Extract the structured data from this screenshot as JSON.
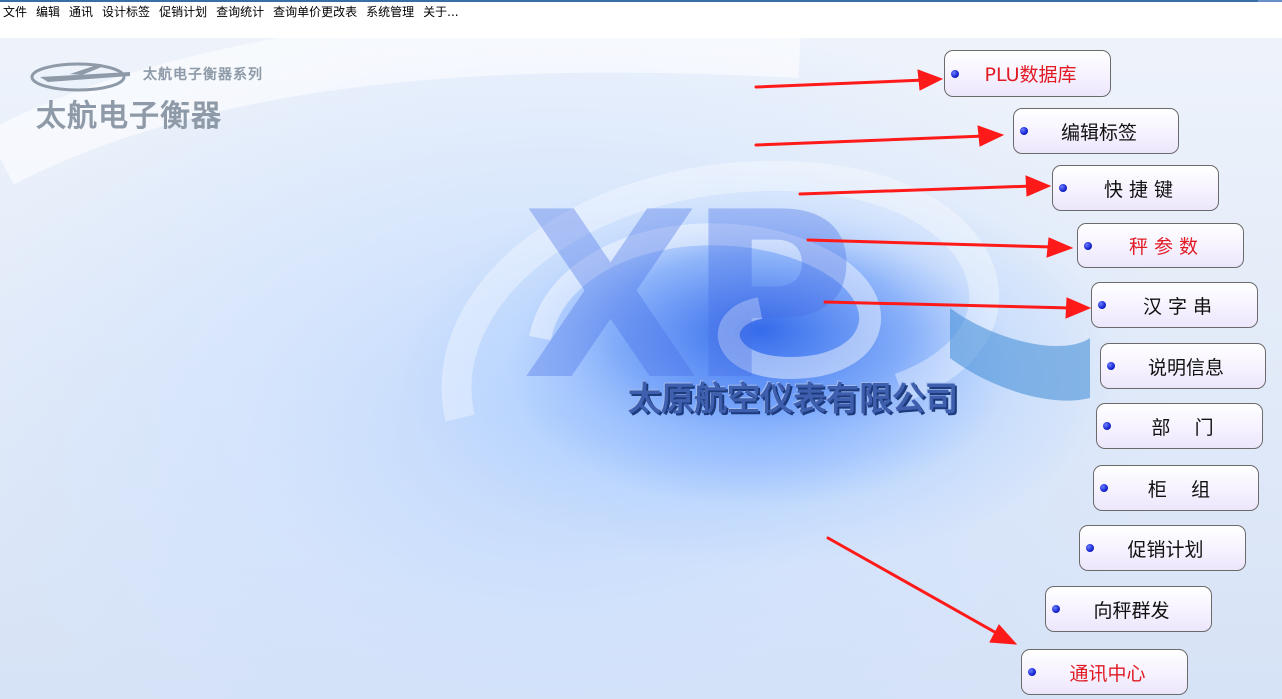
{
  "menu": [
    "文件",
    "编辑",
    "通讯",
    "设计标签",
    "促销计划",
    "查询统计",
    "查询单价更改表",
    "系统管理",
    "关于..."
  ],
  "logo": {
    "subtitle": "太航电子衡器系列",
    "title": "太航电子衡器"
  },
  "watermark": {
    "xp": "XP",
    "company": "太原航空仪表有限公司"
  },
  "buttons": [
    {
      "label": "PLU数据库",
      "highlight": true
    },
    {
      "label": "编辑标签",
      "highlight": false
    },
    {
      "label": "快 捷 键",
      "highlight": false
    },
    {
      "label": "秤 参 数",
      "highlight": true
    },
    {
      "label": "汉 字 串",
      "highlight": false
    },
    {
      "label": "说明信息",
      "highlight": false
    },
    {
      "label": "部    门",
      "highlight": false
    },
    {
      "label": "柜    组",
      "highlight": false
    },
    {
      "label": "促销计划",
      "highlight": false
    },
    {
      "label": "向秤群发",
      "highlight": false
    },
    {
      "label": "通讯中心",
      "highlight": true
    }
  ],
  "colors": {
    "highlight_text": "#e01b24",
    "arrow": "#ff1a1a",
    "bullet": "#1a2bd6"
  }
}
